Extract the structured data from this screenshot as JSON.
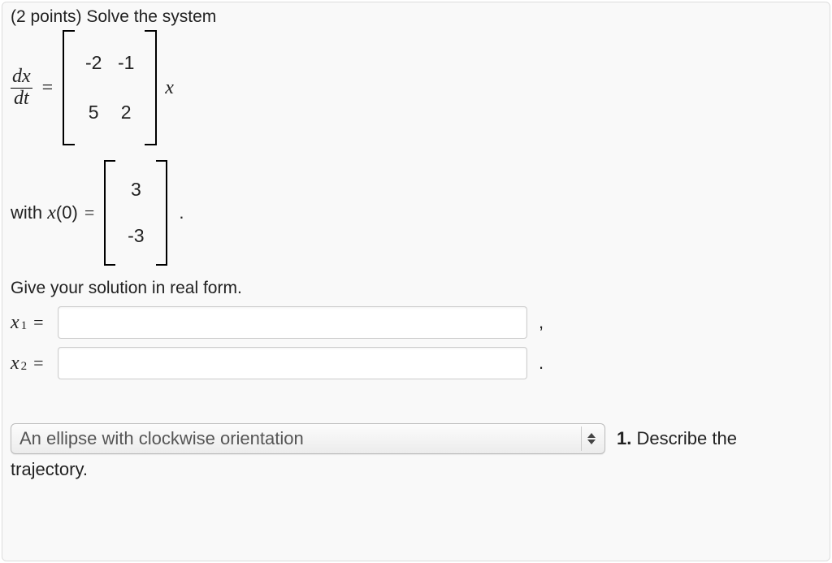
{
  "problem": {
    "prompt": "(2 points) Solve the system",
    "equation": {
      "lhs_num": "dx",
      "lhs_den": "dt",
      "equals": "=",
      "matrix": {
        "a11": "-2",
        "a12": "-1",
        "a21": "5",
        "a22": "2"
      },
      "vector_var": "x"
    },
    "initial": {
      "prefix": "with ",
      "x_label": "x",
      "arg": "(0)",
      "equals": "=",
      "vec": {
        "v1": "3",
        "v2": "-3"
      },
      "period": "."
    },
    "instruction": "Give your solution in real form.",
    "answers": {
      "x1_label_var": "x",
      "x1_sub": "1",
      "x1_eq": "=",
      "x1_value": "",
      "x1_trail": ",",
      "x2_label_var": "x",
      "x2_sub": "2",
      "x2_eq": "=",
      "x2_value": "",
      "x2_trail": "."
    },
    "dropdown": {
      "selected": "An ellipse with clockwise orientation"
    },
    "describe": {
      "number": "1.",
      "text": " Describe the",
      "trajectory_word": "trajectory."
    }
  }
}
